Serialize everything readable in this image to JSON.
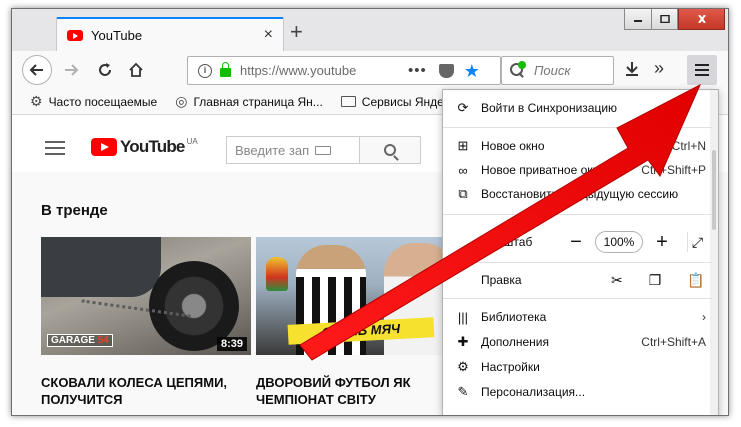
{
  "window": {
    "tab_title": "YouTube",
    "tab_close": "×",
    "new_tab": "+"
  },
  "navbar": {
    "url": "https://www.youtube",
    "page_actions": "•••",
    "search_placeholder": "Поиск",
    "overflow": "»"
  },
  "bookmarks": [
    {
      "label": "Часто посещаемые",
      "icon": "gear-icon"
    },
    {
      "label": "Главная страница Ян...",
      "icon": "globe-icon"
    },
    {
      "label": "Сервисы Яндекс",
      "icon": "folder-icon"
    }
  ],
  "youtube": {
    "logo_text": "YouTube",
    "region": "UA",
    "search_placeholder": "Введите зап",
    "section_title": "В тренде",
    "videos": [
      {
        "title": "СКОВАЛИ КОЛЕСА ЦЕПЯМИ, ПОЛУЧИТСЯ",
        "duration": "8:39",
        "badge": "GARAGE",
        "badge_num": "54"
      },
      {
        "title": "ДВОРОВИЙ ФУТБОЛ ЯК ЧЕМПІОНАТ СВІТУ",
        "duration": "4:",
        "banner": "СКИНЬ МЯЧ"
      }
    ]
  },
  "menu": {
    "sync": "Войти в Синхронизацию",
    "new_window": "Новое окно",
    "new_window_sc": "Ctrl+N",
    "private": "Новое приватное окно",
    "private_sc": "Ctrl+Shift+P",
    "restore": "Восстановить предыдущую сессию",
    "zoom_label": "Масштаб",
    "zoom_value": "100%",
    "zoom_minus": "−",
    "zoom_plus": "+",
    "edit_label": "Правка",
    "library": "Библиотека",
    "library_chevron": "›",
    "addons": "Дополнения",
    "addons_sc": "Ctrl+Shift+A",
    "settings": "Настройки",
    "customize": "Персонализация..."
  },
  "colors": {
    "accent": "#0a84ff",
    "youtube_red": "#ff0000",
    "annotation_arrow": "#ff0000"
  }
}
